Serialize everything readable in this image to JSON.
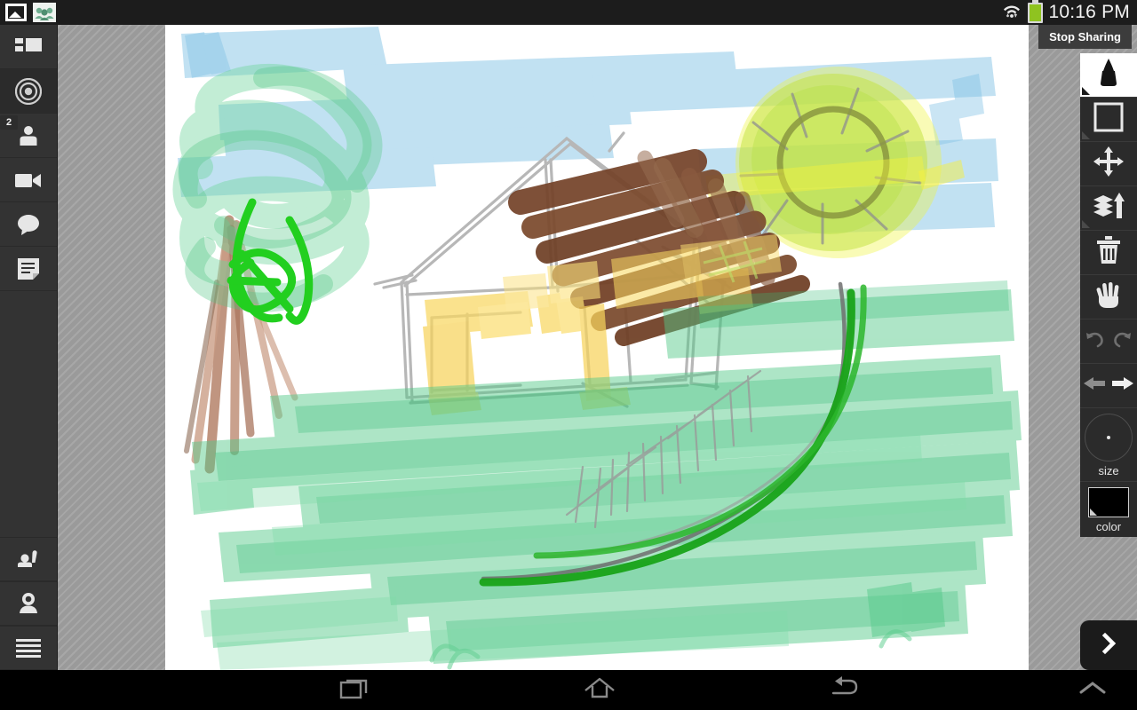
{
  "status_bar": {
    "icons": [
      {
        "name": "gallery-icon",
        "label": "Gallery"
      },
      {
        "name": "people-group-icon",
        "label": "Shared session"
      }
    ],
    "wifi_icon": "wifi-icon",
    "battery_icon": "battery-icon",
    "battery_color": "#8fc320",
    "time": "10:16 PM"
  },
  "sidebar": {
    "items": [
      {
        "name": "sidebar-item-layout",
        "label": "Layout",
        "icon": "layout-panels-icon",
        "active": false,
        "badge": ""
      },
      {
        "name": "sidebar-item-record",
        "label": "Record",
        "icon": "target-record-icon",
        "active": true,
        "badge": ""
      },
      {
        "name": "sidebar-item-participants",
        "label": "Participants",
        "icon": "person-icon",
        "active": false,
        "badge": "2"
      },
      {
        "name": "sidebar-item-video",
        "label": "Video",
        "icon": "video-camera-icon",
        "active": false,
        "badge": ""
      },
      {
        "name": "sidebar-item-chat",
        "label": "Chat",
        "icon": "chat-bubble-icon",
        "active": false,
        "badge": ""
      },
      {
        "name": "sidebar-item-notes",
        "label": "Notes",
        "icon": "notes-document-icon",
        "active": false,
        "badge": ""
      }
    ],
    "bottom_items": [
      {
        "name": "sidebar-item-raise-hand",
        "label": "Raise hand",
        "icon": "raise-hand-icon"
      },
      {
        "name": "sidebar-item-webcam",
        "label": "Webcam",
        "icon": "person-camera-icon"
      },
      {
        "name": "sidebar-item-menu",
        "label": "Menu",
        "icon": "hamburger-menu-icon"
      }
    ]
  },
  "toolbar": {
    "stop_sharing_label": "Stop Sharing",
    "tools": [
      {
        "name": "tool-marker",
        "label": "Marker",
        "icon": "marker-pen-icon",
        "selected": true
      },
      {
        "name": "tool-shape",
        "label": "Shape",
        "icon": "square-shape-icon",
        "selected": false
      },
      {
        "name": "tool-move",
        "label": "Move",
        "icon": "move-arrows-icon",
        "selected": false
      },
      {
        "name": "tool-bring-forward",
        "label": "Bring forward",
        "icon": "layers-arrow-up-icon",
        "selected": false
      },
      {
        "name": "tool-delete",
        "label": "Delete",
        "icon": "trash-icon",
        "selected": false
      },
      {
        "name": "tool-pan",
        "label": "Pan",
        "icon": "hand-icon",
        "selected": false
      }
    ],
    "undo_label": "Undo",
    "redo_label": "Redo",
    "prev_label": "Previous page",
    "next_label": "Next page",
    "size_label": "size",
    "color_label": "color",
    "color_value": "#000000",
    "expand_label": "Expand panel"
  },
  "nav_bar": {
    "recent_label": "Recent apps",
    "home_label": "Home",
    "back_label": "Back",
    "expand_label": "Show navigation"
  },
  "canvas": {
    "name": "whiteboard-canvas",
    "background": "#ffffff",
    "description": "Hand-drawn childlike scene: blue sky strokes, yellow-green sun with rays, tree with green swirl canopy and brown trunk, house with gray sketch outline, brown roof and yellow walls, green grass strokes",
    "palette": {
      "sky_blue": "#a8d4ea",
      "sun_yellow": "#e8f23a",
      "sun_green": "#bde04a",
      "leaf_green": "#7fd9a0",
      "bright_green": "#22cc22",
      "dark_green": "#138b13",
      "trunk_brown": "#c08c72",
      "roof_brown": "#7b4a2d",
      "wall_yellow": "#f8d868",
      "sketch_gray": "#b5b5b5"
    }
  }
}
